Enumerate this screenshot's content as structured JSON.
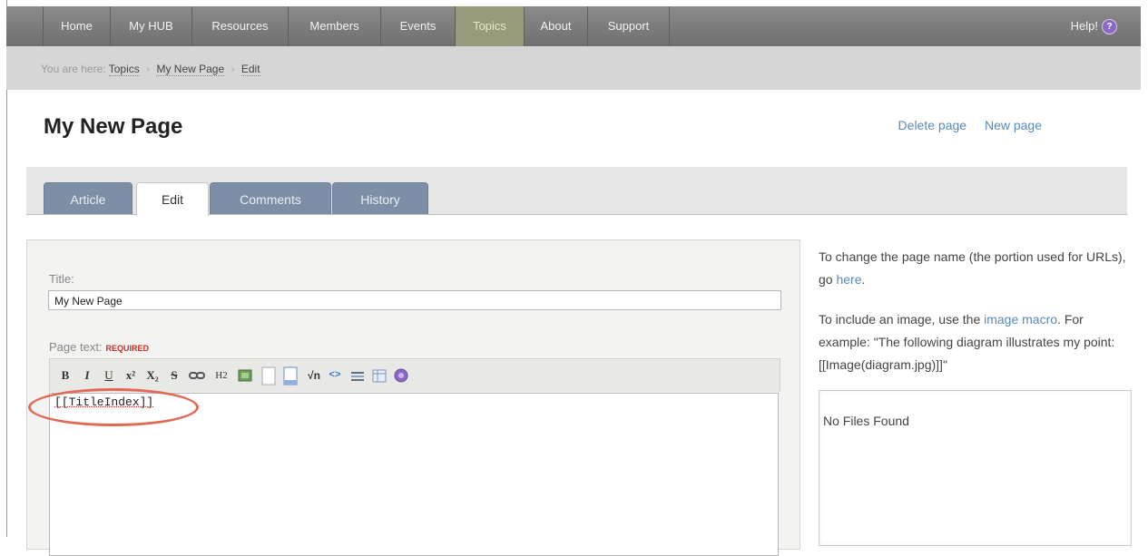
{
  "nav": {
    "items": [
      "Home",
      "My HUB",
      "Resources",
      "Members",
      "Events",
      "Topics",
      "About",
      "Support"
    ],
    "active": "Topics",
    "help_label": "Help!",
    "help_icon": "?"
  },
  "breadcrumb": {
    "prefix": "You are here:",
    "items": [
      "Topics",
      "My New Page",
      "Edit"
    ],
    "separator": "›"
  },
  "page": {
    "title": "My New Page",
    "delete_link": "Delete page",
    "new_link": "New page"
  },
  "tabs": {
    "items": [
      "Article",
      "Edit",
      "Comments",
      "History"
    ],
    "active": "Edit"
  },
  "form": {
    "title_label": "Title:",
    "title_value": "My New Page",
    "pagetext_label": "Page text:",
    "required_label": "REQUIRED",
    "editor_content": "[[TitleIndex]]"
  },
  "toolbar": {
    "buttons": [
      "B",
      "I",
      "U",
      "x²",
      "X₂",
      "S",
      "link",
      "H2",
      "image",
      "page",
      "file",
      "√n",
      "<>",
      "hr",
      "table",
      "help"
    ]
  },
  "sidebar": {
    "help1_a": "To change the page name (the portion used for URLs), go ",
    "help1_link": "here",
    "help1_b": ".",
    "help2_a": "To include an image, use the ",
    "help2_link": "image macro",
    "help2_b": ". For example: \"The following diagram illustrates my point: [[Image(diagram.jpg)]]\"",
    "files_empty": "No Files Found"
  },
  "colors": {
    "nav_bg": "#7f7f7f",
    "nav_active": "#999a7c",
    "link": "#5a8ab8",
    "tab_bg": "#7d8fa6",
    "required": "#c0332b",
    "highlight_oval": "#e06a54"
  }
}
